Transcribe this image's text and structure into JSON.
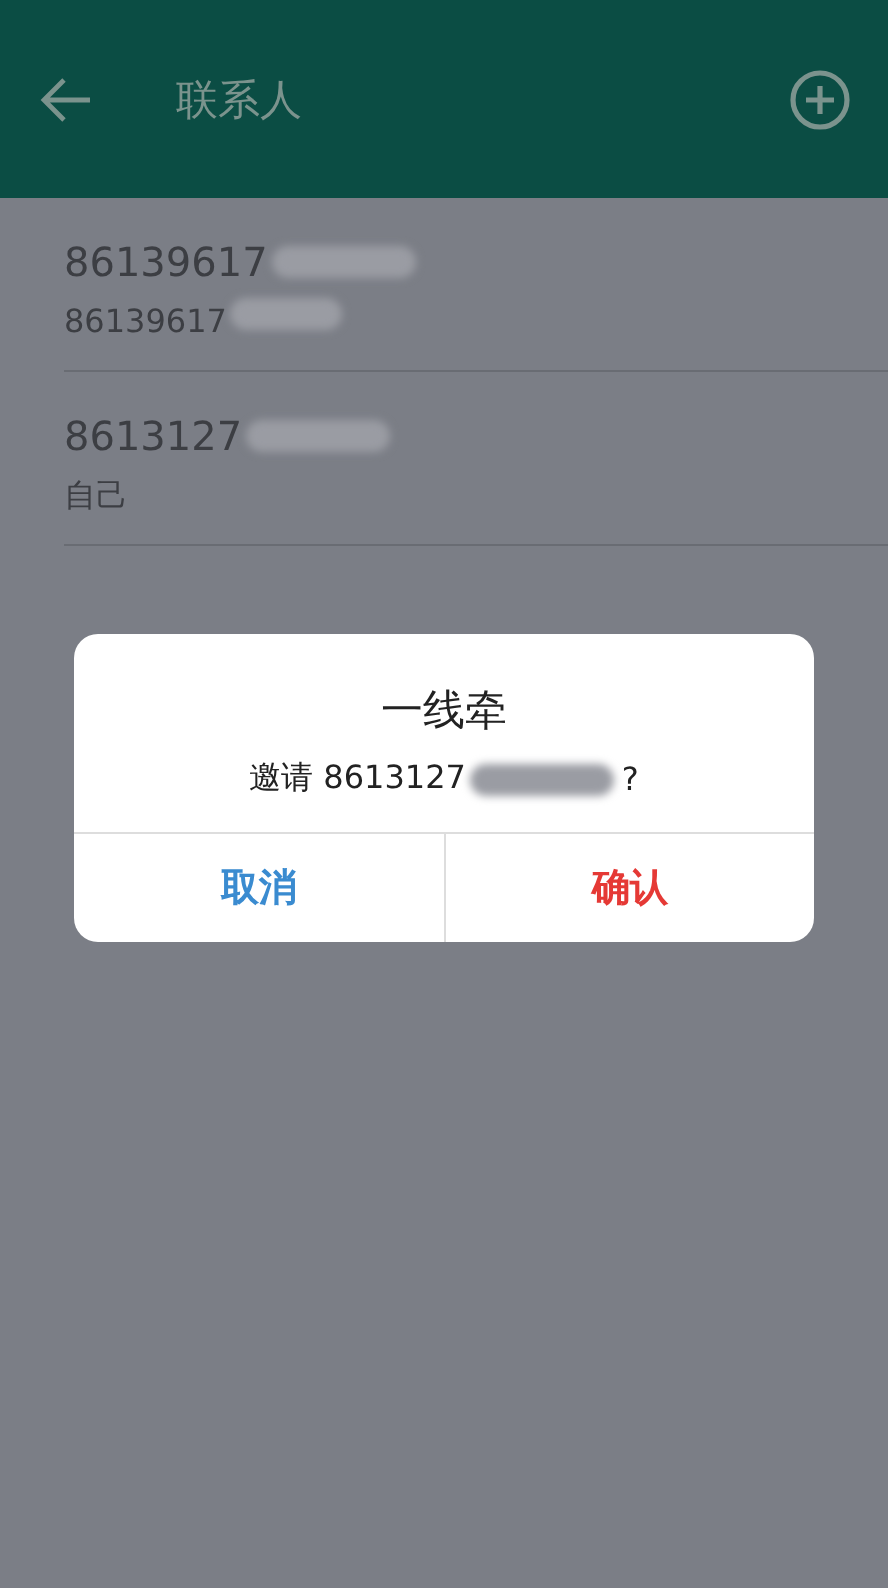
{
  "app_bar": {
    "title": "联系人"
  },
  "contacts": [
    {
      "name": "86139617",
      "subtitle": "86139617"
    },
    {
      "name": "8613127",
      "subtitle": "自己"
    }
  ],
  "dialog": {
    "title": "一线牵",
    "message": "邀请 8613127",
    "message_end": "?",
    "buttons": [
      {
        "label": "取消",
        "kind": "cancel"
      },
      {
        "label": "确认",
        "kind": "confirm"
      }
    ]
  }
}
